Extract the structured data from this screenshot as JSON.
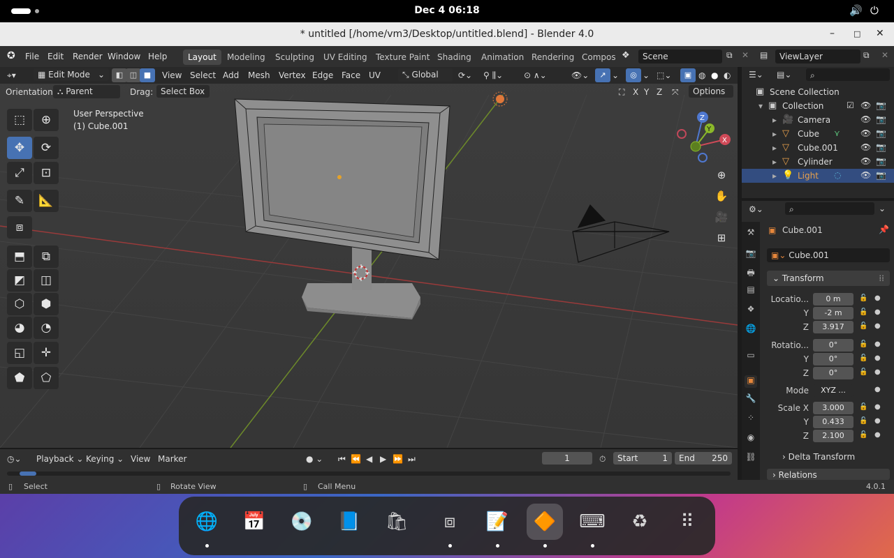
{
  "topbar": {
    "clock": "Dec 4  06:18",
    "volume_icon": "volume-icon",
    "power_icon": "power-icon"
  },
  "window": {
    "title": "* untitled [/home/vm3/Desktop/untitled.blend] - Blender 4.0",
    "minimize": "–",
    "maximize": "□",
    "close": "✕"
  },
  "menu": {
    "items": [
      "File",
      "Edit",
      "Render",
      "Window",
      "Help"
    ],
    "workspaces": [
      "Layout",
      "Modeling",
      "Sculpting",
      "UV Editing",
      "Texture Paint",
      "Shading",
      "Animation",
      "Rendering",
      "Compos"
    ],
    "active_workspace": "Layout",
    "scene": "Scene",
    "view_layer": "ViewLayer"
  },
  "viewport_header": {
    "mode": "Edit Mode",
    "menus": [
      "View",
      "Select",
      "Add",
      "Mesh",
      "Vertex",
      "Edge",
      "Face",
      "UV"
    ],
    "transform_orientation": "Global",
    "orientation_label": "Orientation:",
    "orientation_value": "Parent",
    "drag_label": "Drag:",
    "drag_value": "Select Box",
    "axes": [
      "X",
      "Y",
      "Z"
    ],
    "options": "Options"
  },
  "viewport": {
    "perspective": "User Perspective",
    "object": "(1) Cube.001",
    "gizmo": {
      "x": "X",
      "y": "Y",
      "z": "Z"
    }
  },
  "outliner": {
    "search_placeholder": "",
    "scene_collection": "Scene Collection",
    "collection": "Collection",
    "items": [
      {
        "name": "Camera",
        "icon": "camera-icon"
      },
      {
        "name": "Cube",
        "icon": "mesh-icon"
      },
      {
        "name": "Cube.001",
        "icon": "mesh-icon"
      },
      {
        "name": "Cylinder",
        "icon": "mesh-icon"
      },
      {
        "name": "Light",
        "icon": "light-icon",
        "selected": true
      }
    ]
  },
  "properties": {
    "object_name": "Cube.001",
    "data_name": "Cube.001",
    "transform": "Transform",
    "location_label": "Locatio...",
    "location": [
      "0 m",
      "-2 m",
      "3.917"
    ],
    "rotation_label": "Rotatio...",
    "rotation": [
      "0°",
      "0°",
      "0°"
    ],
    "mode_label": "Mode",
    "mode_value": "XYZ ...",
    "scale_label": "Scale X",
    "scale": [
      "3.000",
      "0.433",
      "2.100"
    ],
    "axis_y": "Y",
    "axis_z": "Z",
    "delta_transform": "Delta Transform",
    "relations": "Relations"
  },
  "timeline": {
    "menus": [
      "Playback",
      "Keying",
      "View",
      "Marker"
    ],
    "current_frame": "1",
    "start_label": "Start",
    "start": "1",
    "end_label": "End",
    "end": "250"
  },
  "statusbar": {
    "select": "Select",
    "rotate": "Rotate View",
    "call_menu": "Call Menu",
    "version": "4.0.1"
  },
  "colors": {
    "accent": "#4772b3",
    "selected_row": "#334d80",
    "object_orange": "#e6873b"
  }
}
